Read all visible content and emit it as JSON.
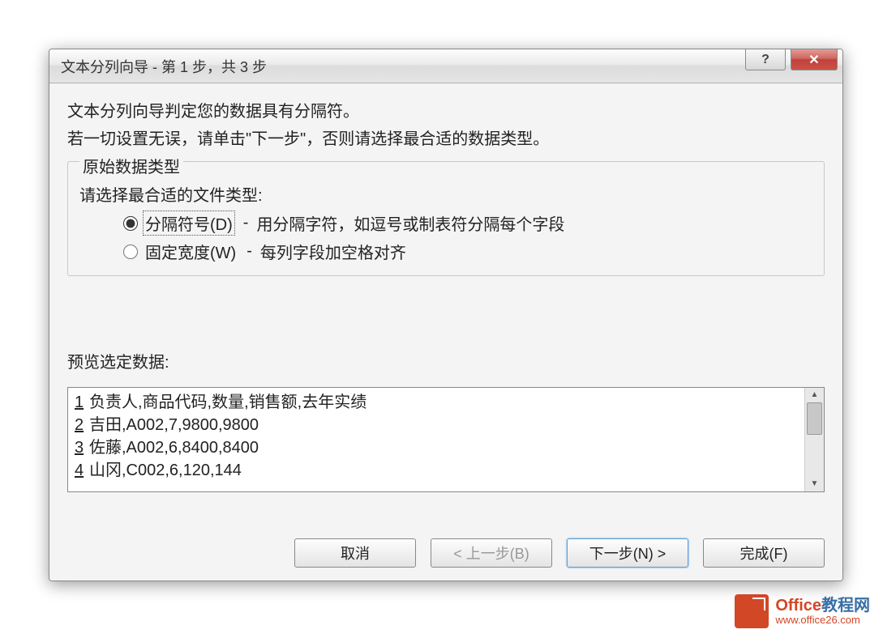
{
  "dialog": {
    "title": "文本分列向导 - 第 1 步，共 3 步"
  },
  "intro": {
    "line1": "文本分列向导判定您的数据具有分隔符。",
    "line2": "若一切设置无误，请单击\"下一步\"，否则请选择最合适的数据类型。"
  },
  "group": {
    "legend": "原始数据类型",
    "prompt": "请选择最合适的文件类型:",
    "options": [
      {
        "label": "分隔符号(D)",
        "desc": "用分隔字符，如逗号或制表符分隔每个字段",
        "checked": true
      },
      {
        "label": "固定宽度(W)",
        "desc": "每列字段加空格对齐",
        "checked": false
      }
    ],
    "dash": "-"
  },
  "preview": {
    "label": "预览选定数据:",
    "lines": [
      {
        "num": "1",
        "text": "负责人,商品代码,数量,销售额,去年实绩"
      },
      {
        "num": "2",
        "text": "吉田,A002,7,9800,9800"
      },
      {
        "num": "3",
        "text": "佐藤,A002,6,8400,8400"
      },
      {
        "num": "4",
        "text": "山冈,C002,6,120,144"
      }
    ]
  },
  "buttons": {
    "cancel": "取消",
    "back": "< 上一步(B)",
    "next": "下一步(N) >",
    "finish": "完成(F)"
  },
  "watermark": {
    "icon_text": "",
    "title_orange": "Office",
    "title_blue": "教程网",
    "url": "www.office26.com"
  }
}
